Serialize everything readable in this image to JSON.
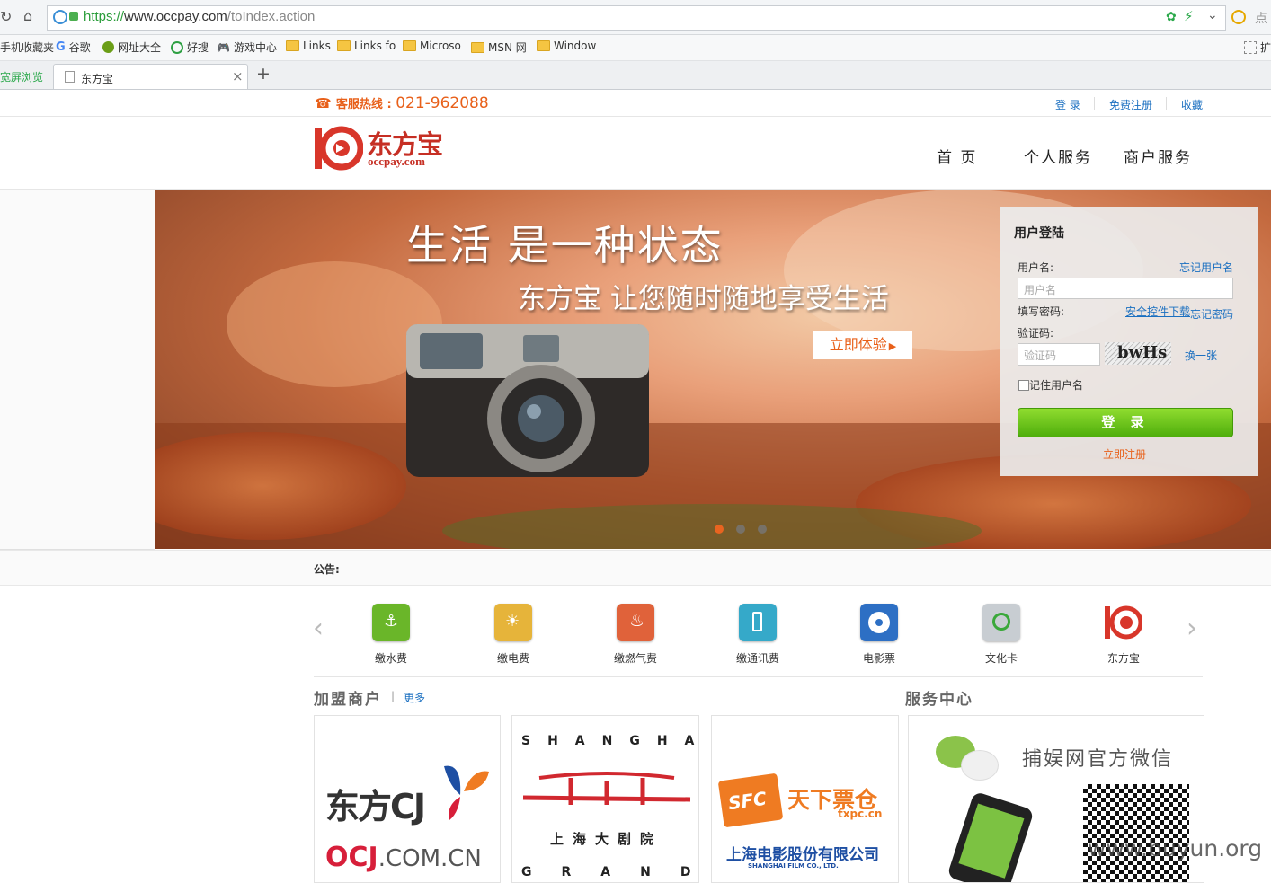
{
  "browser": {
    "url_scheme": "https://",
    "url_host": "www.occpay.com",
    "url_path": "/toIndex.action",
    "right_text": "点",
    "favorites": [
      "手机收藏夹",
      "谷歌",
      "网址大全",
      "好搜",
      "游戏中心",
      "Links",
      "Links fo",
      "Microso",
      "MSN 网",
      "Window"
    ],
    "extension_label": "扩",
    "left_tab_label": "宽屏浏览",
    "tab_title": "东方宝",
    "tab_close": "×",
    "new_tab": "+"
  },
  "site": {
    "hotline_label": "客服热线 : ",
    "hotline_number": "021-962088",
    "top_links": [
      "登 录",
      "免费注册",
      "收藏"
    ],
    "logo_cn": "东方宝",
    "logo_en": "occpay.com",
    "nav": [
      "首 页",
      "个人服务",
      "商户服务"
    ],
    "banner": {
      "headline": "生活 是一种状态",
      "subline": "东方宝 让您随时随地享受生活",
      "cta": "立即体验"
    },
    "login": {
      "title": "用户登陆",
      "username_label": "用户名:",
      "forgot_username": "忘记用户名",
      "username_placeholder": "用户名",
      "password_label": "填写密码:",
      "security_download": "安全控件下载",
      "forgot_password": "忘记密码",
      "captcha_label": "验证码:",
      "captcha_placeholder": "验证码",
      "captcha_text": "bwHs",
      "refresh_captcha": "换一张",
      "remember_label": "记住用户名",
      "login_button": "登 录",
      "register_link": "立即注册"
    },
    "notice_label": "公告:",
    "services": [
      {
        "label": "缴水费",
        "color": "#6ab629"
      },
      {
        "label": "缴电费",
        "color": "#e6b43a"
      },
      {
        "label": "缴燃气费",
        "color": "#e0623a"
      },
      {
        "label": "缴通讯费",
        "color": "#35a9c9"
      },
      {
        "label": "电影票",
        "color": "#2d6fc4"
      },
      {
        "label": "文化卡",
        "color": "#c8cdd2"
      },
      {
        "label": "东方宝",
        "color": "#d8362a"
      }
    ],
    "merchants_title": "加盟商户",
    "merchants_sep": "|",
    "more_link": "更多",
    "service_center_title": "服务中心",
    "cards": {
      "cj_brand": "东方CJ",
      "ocj_brand": "OCJ",
      "ocj_domain": ".COM.CN",
      "theatre_top": "SHANGHAI",
      "theatre_cn": "上海大剧院",
      "theatre_bottom": "GRAND",
      "sfc_badge": "SFC",
      "sfc_name": "天下票仓",
      "sfc_domain": "txpc.cn",
      "film_co_cn": "上海电影股份有限公司",
      "film_co_en": "SHANGHAI FILM CO., LTD.",
      "wechat_title": "捕娱网官方微信",
      "watermark": "www.buyun.org"
    }
  }
}
